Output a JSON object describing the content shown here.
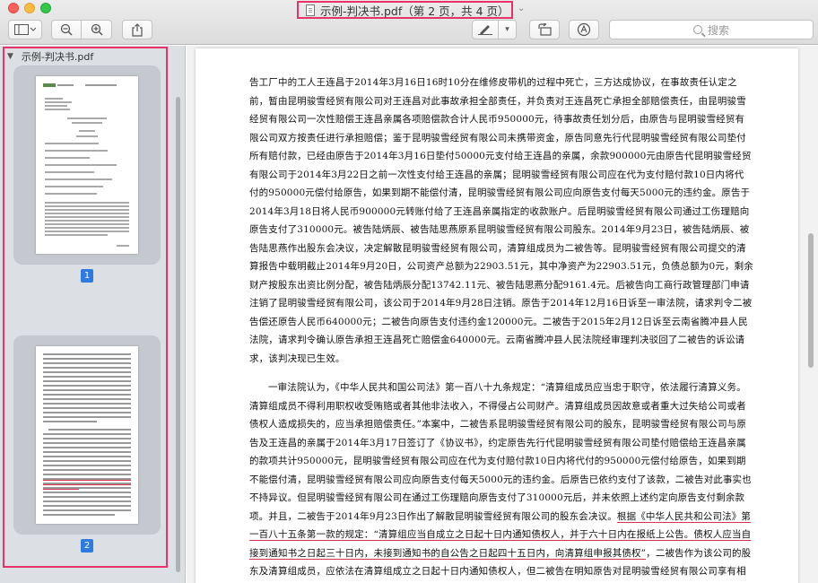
{
  "window": {
    "title": "示例-判决书.pdf（第 2 页，共 4 页）"
  },
  "toolbar": {
    "sidebar_toggle_icon": "sidebar-icon",
    "zoom_out_icon": "zoom-out-icon",
    "zoom_in_icon": "zoom-in-icon",
    "share_icon": "share-icon",
    "markup_icon": "pen-icon",
    "rotate_icon": "rotate-icon",
    "annotate_icon": "markup-circle-icon",
    "search_placeholder": "搜索"
  },
  "sidebar": {
    "file_name": "示例-判决书.pdf",
    "thumbnails": [
      {
        "page_number": "1"
      },
      {
        "page_number": "2"
      }
    ]
  },
  "document": {
    "paragraph1": "告工厂中的工人王连昌于2014年3月16日16时10分在维修皮带机的过程中死亡，三方达成协议，在事故责任认定之前，暂由昆明骏雪经贸有限公司对王连昌对此事故承担全部责任，并负责对王连昌死亡承担全部赔偿责任，由昆明骏雪经贸有限公司一次性赔偿王连昌亲属各项赔偿款合计人民币950000元，待事故责任划分后，由原告与昆明骏雪经贸有限公司双方按责任进行承担赔偿；鉴于昆明骏雪经贸有限公司未携带资金，原告同意先行代昆明骏雪经贸有限公司垫付所有赔付款，已经由原告于2014年3月16日垫付50000元支付给王连昌的亲属，余款900000元由原告代昆明骏雪经贸有限公司于2014年3月22日之前一次性支付给王连昌的亲属；昆明骏雪经贸有限公司应在代为支付赔付款10日内将代付的950000元偿付给原告，如果到期不能偿付清，昆明骏雪经贸有限公司应向原告支付每天5000元的违约金。原告于2014年3月18日将人民币900000元转账付给了王连昌亲属指定的收款账户。后昆明骏雪经贸有限公司通过工伤理赔向原告支付了310000元。被告陆炳辰、被告陆思燕原系昆明骏雪经贸有限公司股东。2014年9月23日，被告陆炳辰、被告陆思燕作出股东会决议，决定解散昆明骏雪经贸有限公司，清算组成员为二被告等。昆明骏雪经贸有限公司提交的清算报告中载明截止2014年9月20日，公司资产总额为22903.51元，其中净资产为22903.51元，负债总额为0元，剩余财产按股东出资比例分配，被告陆炳辰分配13742.11元、被告陆思燕分配9161.4元。后被告向工商行政管理部门申请注销了昆明骏雪经贸有限公司，该公司于2014年9月28日注销。原告于2014年12月16日诉至一审法院，请求判令二被告偿还原告人民币640000元；二被告向原告支付违约金120000元。二被告于2015年2月12日诉至云南省腾冲县人民法院，请求判令确认原告承担王连昌死亡赔偿金640000元。云南省腾冲县人民法院经审理判决驳回了二被告的诉讼请求，该判决现已生效。",
    "paragraph2_before": "一审法院认为，《中华人民共和国公司法》第一百八十九条规定：“清算组成员应当忠于职守，依法履行清算义务。清算组成员不得利用职权收受贿赂或者其他非法收入，不得侵占公司财产。清算组成员因故意或者重大过失给公司或者债权人造成损失的，应当承担赔偿责任。”本案中，二被告系昆明骏雪经贸有限公司的股东，昆明骏雪经贸有限公司与原告及王连昌的亲属于2014年3月17日签订了《协议书》，约定原告先行代昆明骏雪经贸有限公司垫付赔偿给王连昌亲属的款项共计950000元，昆明骏雪经贸有限公司应在代为支付赔付款10日内将代付的950000元偿付给原告，如果到期不能偿付清，昆明骏雪经贸有限公司应向原告支付每天5000元的违约金。后原告已依约支付了该款，二被告对此事实也不持异议。但昆明骏雪经贸有限公司在通过工伤理赔向原告支付了310000元后，并未依照上述约定向原告支付剩余款项。并且，二被告于2014年9月23日作出了解散昆明骏雪经贸有限公司的股东会决议。",
    "paragraph2_underlined": "根据《中华人民共和公司法》第一百八十五条第一款的规定：“清算组应当自成立之日起十日内通知债权人，并于六十日内在报纸上公告。债权人应当自接到通知书之日起三十日内，未接到通知书的自公告之日起四十五日内，向清算组申报其债权”",
    "paragraph2_after": "，二被告作为该公司的股东及清算组成员，应依法在清算组成立之日起十日内通知债权人，但二被告在明知原告对昆明骏雪经贸有限公司享有相应债权的情况下，并未履行通知债权人的法定义务，而在被告向工商行政管理部门提"
  }
}
